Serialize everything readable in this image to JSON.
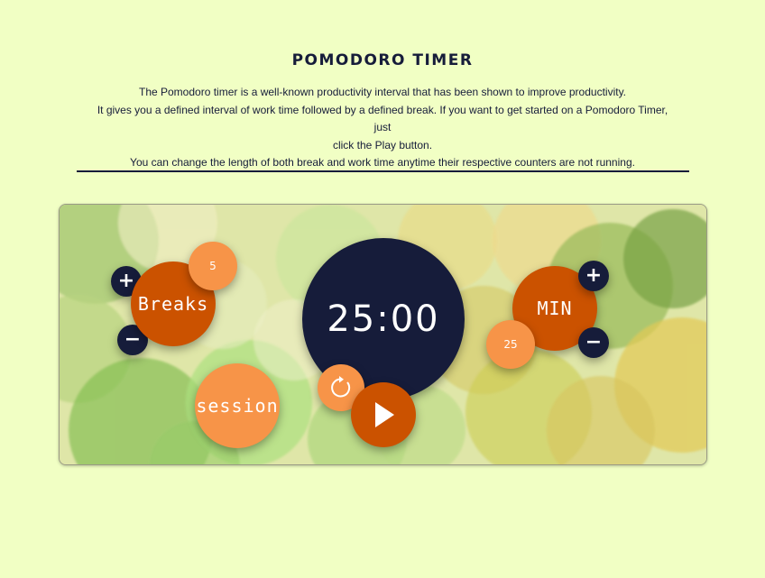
{
  "header": {
    "title": "POMODORO TIMER",
    "description_lines": [
      "The Pomodoro timer is a well-known productivity interval that has been shown to improve productivity.",
      "It gives you a defined interval of work time followed by a defined break. If you want to get started on a Pomodoro Timer, just",
      "click the Play button.",
      "You can change the length of both break and work time anytime their respective counters are not running."
    ]
  },
  "timer": {
    "breaks_label": "Breaks",
    "breaks_value": "5",
    "breaks_plus": "+",
    "breaks_minus": "−",
    "display": "25:00",
    "min_label": "MIN",
    "min_value": "25",
    "min_plus": "+",
    "min_minus": "−",
    "session_label": "session",
    "reset_icon": "reset-icon",
    "play_icon": "play-icon"
  },
  "colors": {
    "page_bg": "#f1ffc4",
    "navy": "#161c3a",
    "orange": "#cb5200",
    "light_orange": "#f79448"
  }
}
